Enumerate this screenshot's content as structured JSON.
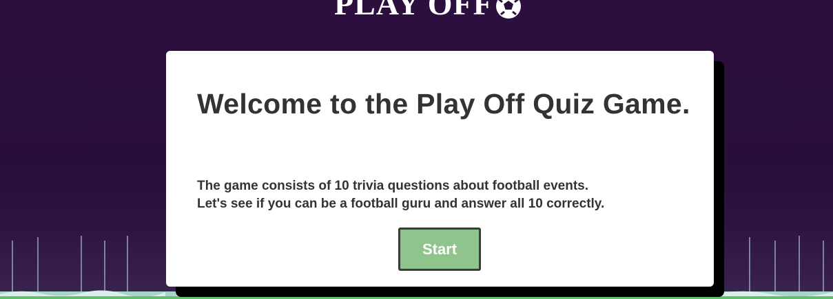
{
  "header": {
    "logo_text": "PLAY OFF",
    "logo_icon": "soccer-ball-icon"
  },
  "card": {
    "title": "Welcome to the Play Off Quiz Game.",
    "description_line1": "The game consists of 10 trivia questions about football events.",
    "description_line2": "Let's see if you can be a football guru and answer all 10 correctly.",
    "start_label": "Start"
  },
  "colors": {
    "background": "#2a0f3b",
    "card": "#ffffff",
    "text": "#333333",
    "start_button": "#8fc48c",
    "card_shadow": "#000000"
  }
}
